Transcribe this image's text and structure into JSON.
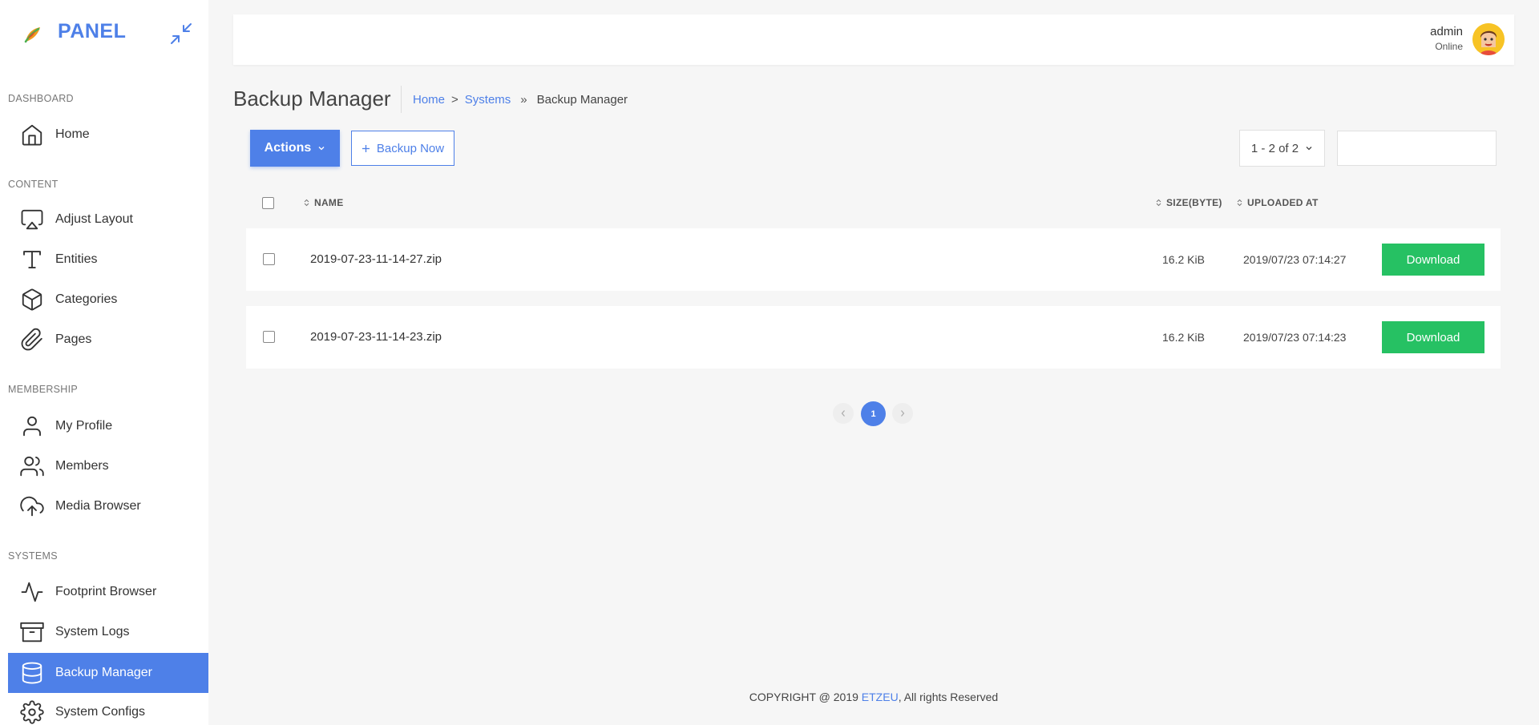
{
  "brand": {
    "name": "PANEL"
  },
  "sidebar": {
    "sections": [
      {
        "label": "DASHBOARD",
        "items": [
          {
            "label": "Home",
            "icon": "home-icon"
          }
        ]
      },
      {
        "label": "CONTENT",
        "items": [
          {
            "label": "Adjust Layout",
            "icon": "airplay-icon"
          },
          {
            "label": "Entities",
            "icon": "type-icon"
          },
          {
            "label": "Categories",
            "icon": "box-icon"
          },
          {
            "label": "Pages",
            "icon": "paperclip-icon"
          }
        ]
      },
      {
        "label": "MEMBERSHIP",
        "items": [
          {
            "label": "My Profile",
            "icon": "user-icon"
          },
          {
            "label": "Members",
            "icon": "users-icon"
          },
          {
            "label": "Media Browser",
            "icon": "upload-cloud-icon"
          }
        ]
      },
      {
        "label": "SYSTEMS",
        "items": [
          {
            "label": "Footprint Browser",
            "icon": "activity-icon"
          },
          {
            "label": "System Logs",
            "icon": "archive-icon"
          },
          {
            "label": "Backup Manager",
            "icon": "database-icon",
            "active": true
          },
          {
            "label": "System Configs",
            "icon": "settings-icon"
          }
        ]
      }
    ]
  },
  "topbar": {
    "user_name": "admin",
    "user_status": "Online"
  },
  "page": {
    "title": "Backup Manager",
    "breadcrumb": {
      "home": "Home",
      "sep1": ">",
      "systems": "Systems",
      "sep2": "»",
      "current": "Backup Manager"
    }
  },
  "toolbar": {
    "actions_label": "Actions",
    "backup_now_label": "Backup Now",
    "pager_label": "1 - 2 of 2",
    "search_placeholder": ""
  },
  "table": {
    "headers": {
      "name": "NAME",
      "size": "SIZE(BYTE)",
      "uploaded_at": "UPLOADED AT"
    },
    "rows": [
      {
        "name": "2019-07-23-11-14-27.zip",
        "size": "16.2 KiB",
        "uploaded_at": "2019/07/23 07:14:27",
        "action": "Download"
      },
      {
        "name": "2019-07-23-11-14-23.zip",
        "size": "16.2 KiB",
        "uploaded_at": "2019/07/23 07:14:23",
        "action": "Download"
      }
    ]
  },
  "pagination": {
    "current": "1"
  },
  "footer": {
    "prefix": "COPYRIGHT @ 2019 ",
    "brand": "ETZEU",
    "suffix": ", All rights Reserved"
  },
  "colors": {
    "accent": "#4e80e8",
    "success": "#26c163",
    "background": "#f6f6f6"
  }
}
